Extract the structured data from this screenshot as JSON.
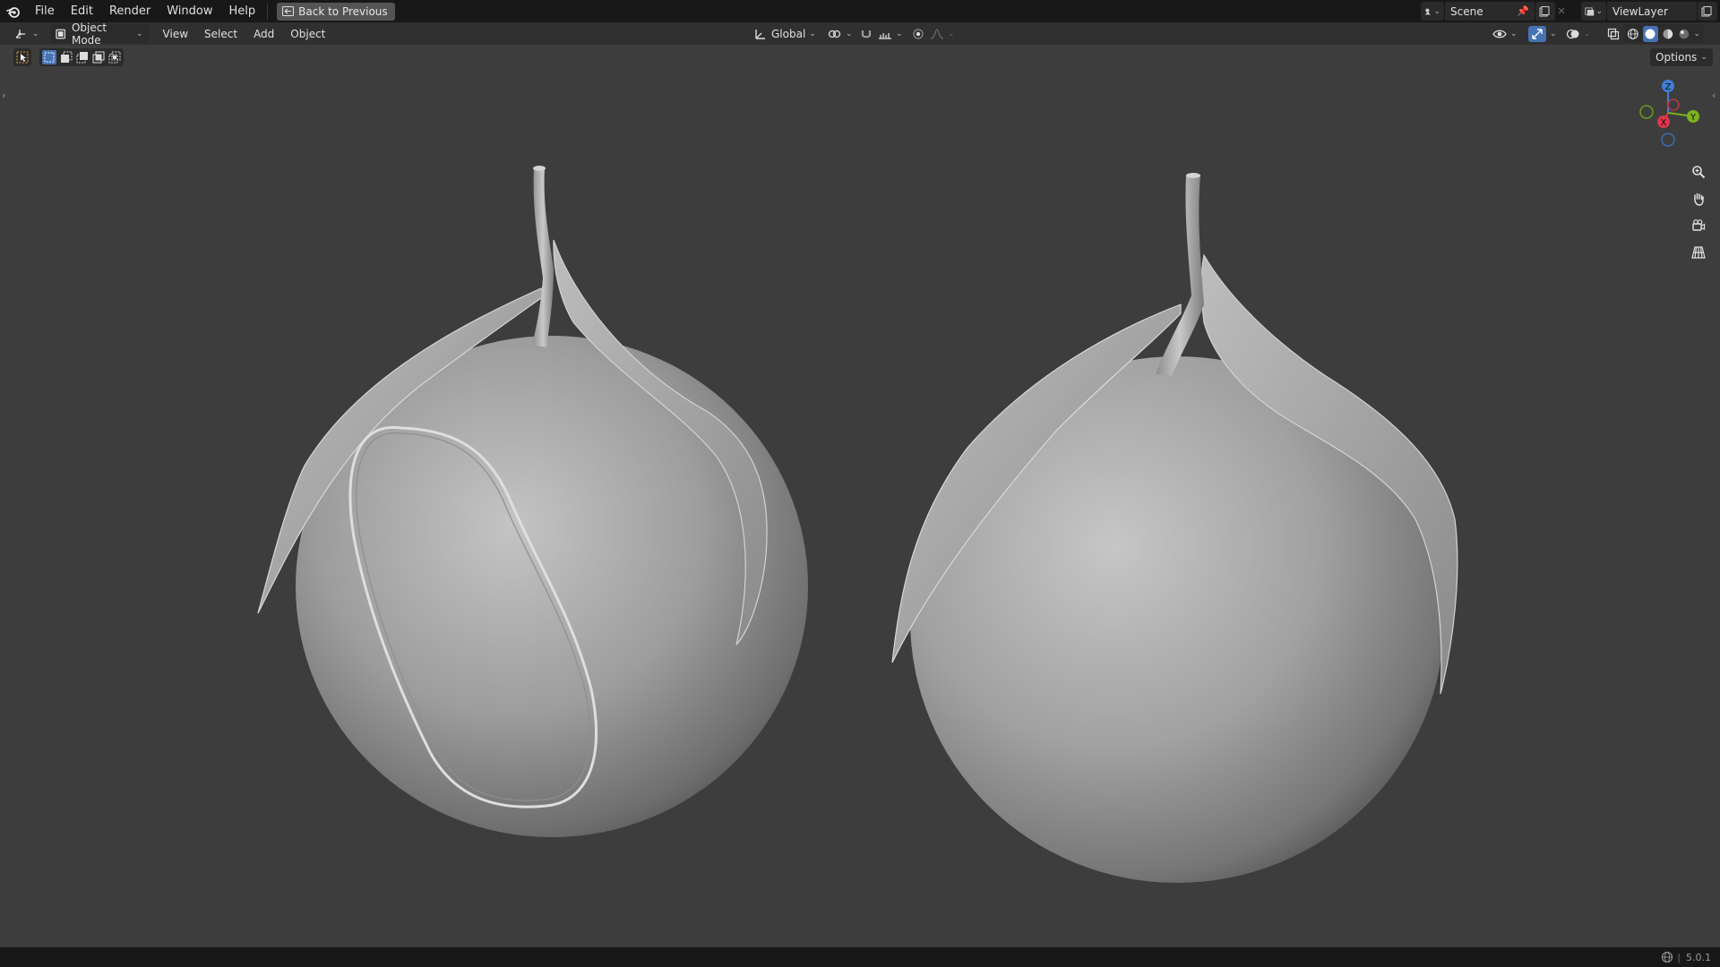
{
  "menubar": {
    "items": [
      "File",
      "Edit",
      "Render",
      "Window",
      "Help"
    ],
    "back_button": "Back to Previous",
    "scene": "Scene",
    "view_layer": "ViewLayer"
  },
  "viewport_header": {
    "mode": "Object Mode",
    "menus": [
      "View",
      "Select",
      "Add",
      "Object"
    ],
    "orientation": "Global",
    "options": "Options"
  },
  "gizmo": {
    "x_label": "X",
    "y_label": "Y",
    "z_label": "Z"
  },
  "statusbar": {
    "version": "5.0.1"
  },
  "colors": {
    "accent": "#4772b3",
    "x_axis": "#e0354a",
    "y_axis": "#7bb21e",
    "z_axis": "#3d7fd9"
  }
}
